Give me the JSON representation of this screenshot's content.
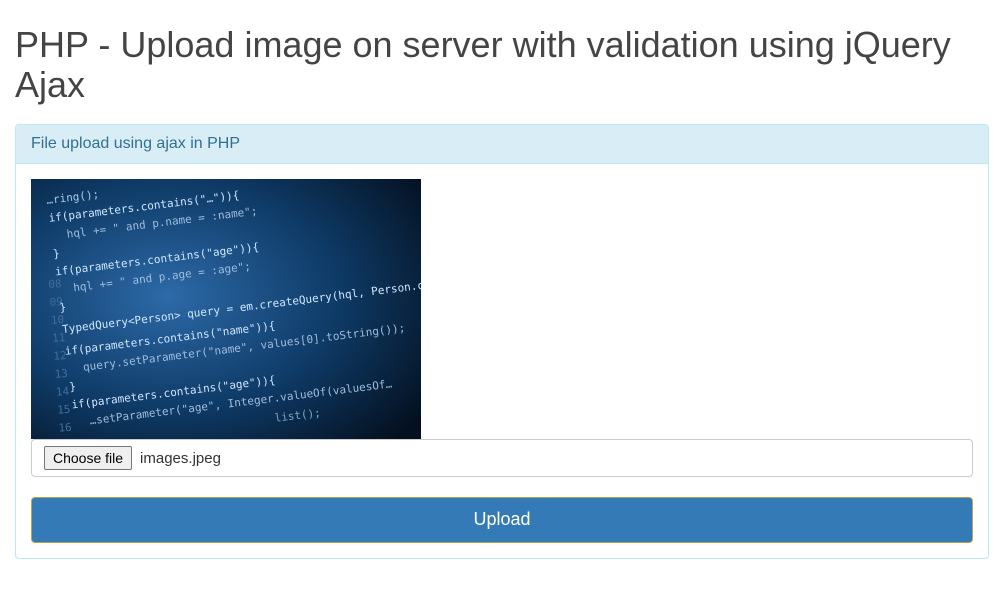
{
  "page": {
    "title": "PHP - Upload image on server with validation using jQuery Ajax"
  },
  "panel": {
    "heading": "File upload using ajax in PHP"
  },
  "form": {
    "choose_label": "Choose file",
    "file_name": "images.jpeg",
    "upload_label": "Upload"
  },
  "preview": {
    "alt": "code-image-preview"
  }
}
